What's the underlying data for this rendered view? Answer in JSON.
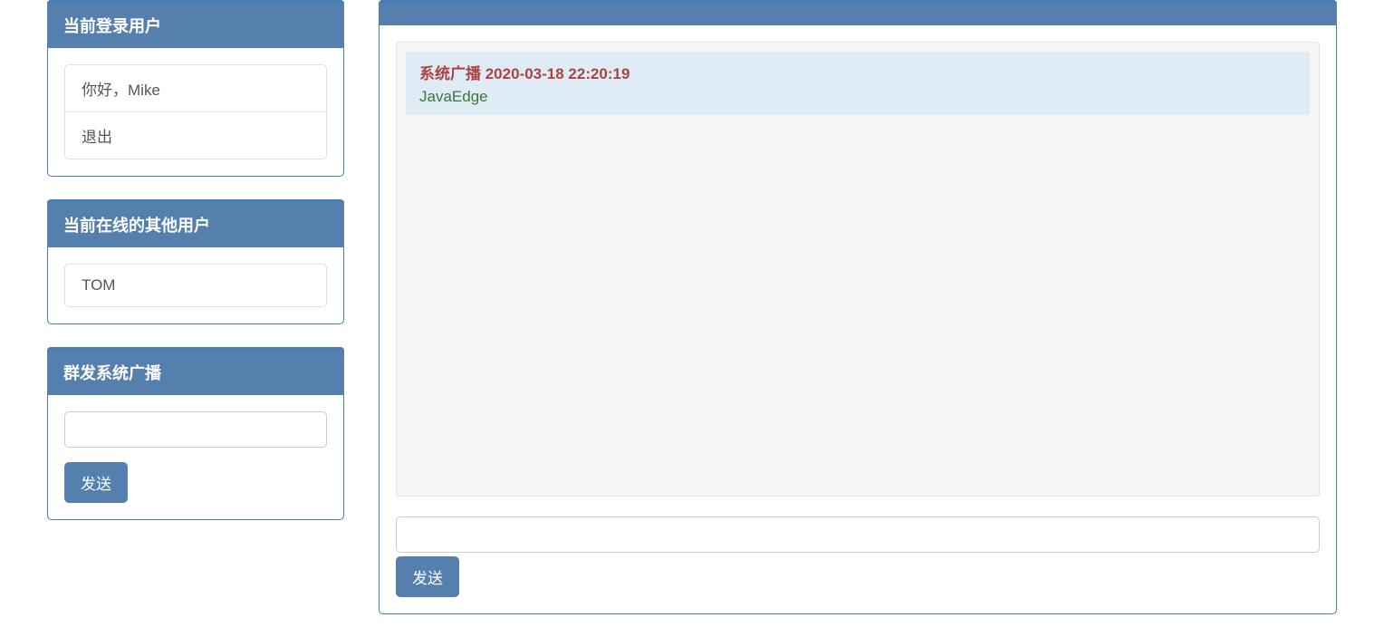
{
  "sidebar": {
    "current_user_panel": {
      "title": "当前登录用户",
      "greeting": "你好，Mike",
      "logout": "退出"
    },
    "online_users_panel": {
      "title": "当前在线的其他用户",
      "users": [
        "TOM"
      ]
    },
    "broadcast_panel": {
      "title": "群发系统广播",
      "input_value": "",
      "send_label": "发送"
    }
  },
  "chat": {
    "messages": [
      {
        "header": "系统广播 2020-03-18 22:20:19",
        "body": "JavaEdge"
      }
    ],
    "input_value": "",
    "send_label": "发送"
  }
}
